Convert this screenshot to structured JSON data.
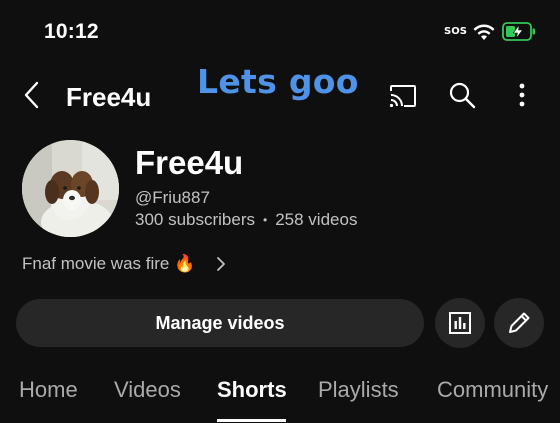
{
  "status_bar": {
    "time": "10:12",
    "sos": "SOS"
  },
  "top_bar": {
    "title": "Free4u",
    "overlay_text": "Lets goo"
  },
  "channel": {
    "name": "Free4u",
    "handle": "@Friu887",
    "subscribers": "300 subscribers",
    "separator": "•",
    "videos": "258 videos",
    "description": "Fnaf movie was fire 🔥"
  },
  "actions": {
    "manage_label": "Manage videos"
  },
  "tabs": [
    {
      "label": "Home"
    },
    {
      "label": "Videos"
    },
    {
      "label": "Shorts"
    },
    {
      "label": "Playlists"
    },
    {
      "label": "Community"
    }
  ],
  "active_tab": "Shorts",
  "colors": {
    "background": "#0f0f0f",
    "overlay_text": "#4f93e8",
    "battery": "#34c759",
    "button_bg": "#272727"
  }
}
